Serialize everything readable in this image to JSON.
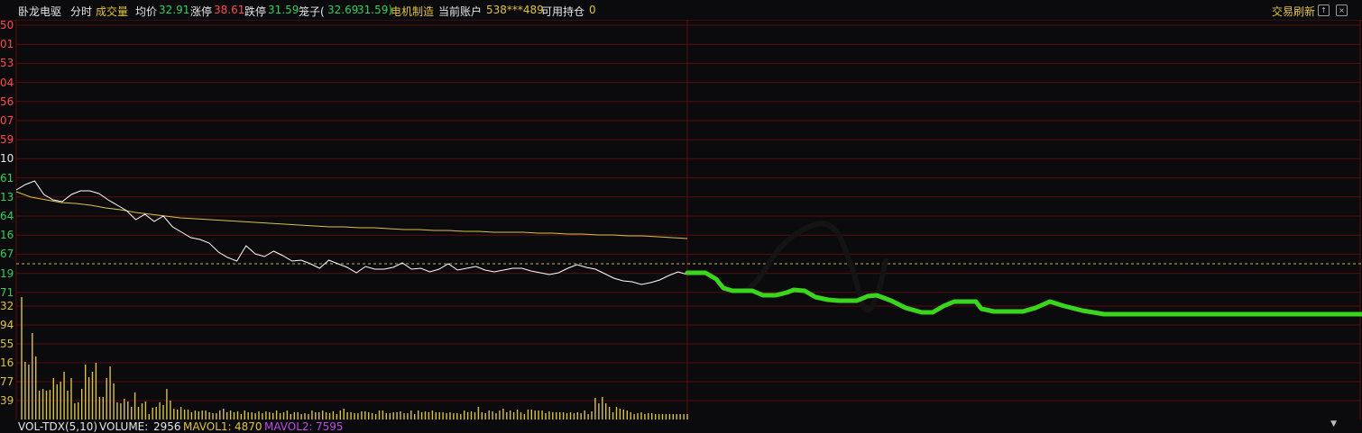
{
  "header": {
    "stock_name": "卧龙电驱",
    "mode_label": "分时",
    "volume_label": "成交量",
    "avg_label": "均价",
    "avg_value": "32.91",
    "limit_up_label": "涨停",
    "limit_up_value": "38.61",
    "limit_down_label": "跌停",
    "limit_down_value": "31.59",
    "basket_label": "笼子(",
    "basket_high": "32.69",
    "basket_low": "31.59)",
    "sector": "电机制造",
    "account_label": "当前账户",
    "account_value": "538***489",
    "position_label": "可用持仓",
    "position_value": "0",
    "refresh_label": "交易刷新"
  },
  "left_axis_labels": [
    {
      "text": "50",
      "color": "red"
    },
    {
      "text": "01",
      "color": "red"
    },
    {
      "text": "53",
      "color": "red"
    },
    {
      "text": "04",
      "color": "red"
    },
    {
      "text": "56",
      "color": "red"
    },
    {
      "text": "07",
      "color": "red"
    },
    {
      "text": "59",
      "color": "red"
    },
    {
      "text": "10",
      "color": "white"
    },
    {
      "text": "61",
      "color": "green"
    },
    {
      "text": "13",
      "color": "green"
    },
    {
      "text": "64",
      "color": "green"
    },
    {
      "text": "16",
      "color": "green"
    },
    {
      "text": "67",
      "color": "green"
    },
    {
      "text": "19",
      "color": "green"
    },
    {
      "text": "71",
      "color": "green"
    },
    {
      "text": "32",
      "color": "yellow"
    },
    {
      "text": "94",
      "color": "yellow"
    },
    {
      "text": "55",
      "color": "yellow"
    },
    {
      "text": "16",
      "color": "yellow"
    },
    {
      "text": "77",
      "color": "yellow"
    },
    {
      "text": "39",
      "color": "yellow"
    }
  ],
  "footer": {
    "indicator": "VOL-TDX(5,10)",
    "volume_label": "VOLUME:",
    "volume_value": "2956",
    "mavol1_label": "MAVOL1:",
    "mavol1_value": "4870",
    "mavol2_label": "MAVOL2:",
    "mavol2_value": "7595"
  },
  "colors": {
    "grid": "#5a0d0d",
    "price_line": "#ffffff",
    "avg_line": "#d8c24a",
    "drawn_green": "#3ad61e",
    "drawn_black": "#141414",
    "volume_bar": "#d8c24a"
  },
  "chart_data": {
    "type": "line",
    "series": [
      {
        "values": [
          211,
          205,
          201,
          216,
          222,
          224,
          216,
          212,
          212,
          215,
          222,
          228,
          234,
          244,
          238,
          246,
          240,
          252,
          258,
          264,
          266,
          270,
          280,
          286,
          290,
          273,
          282,
          285,
          279,
          284,
          290,
          289,
          293,
          298,
          289,
          293,
          297,
          303,
          296,
          299,
          299,
          297,
          292,
          299,
          298,
          302,
          299,
          293,
          300,
          298,
          296,
          300,
          302,
          300,
          298,
          298,
          301,
          303,
          305,
          303,
          298,
          294,
          297,
          299,
          304,
          309,
          312,
          313,
          316,
          314,
          311,
          306,
          302,
          305
        ]
      },
      {
        "values": [
          213,
          219,
          222,
          225,
          226,
          228,
          231,
          233,
          236,
          238,
          240,
          242,
          243,
          244,
          245,
          246,
          247,
          248,
          249,
          250,
          251,
          252,
          252,
          253,
          253,
          254,
          255,
          255,
          256,
          256,
          257,
          257,
          258,
          258,
          258,
          259,
          259,
          260,
          260,
          261,
          261,
          262,
          262,
          263,
          264,
          265
        ]
      },
      {
        "values": [
          330,
          402,
          405,
          370,
          396,
          434,
          432,
          434,
          433,
          420,
          427,
          424,
          413,
          434,
          420,
          448,
          447,
          432,
          405,
          419,
          413,
          403,
          441,
          441,
          420,
          407,
          426,
          447,
          448,
          443,
          446,
          452,
          436,
          452,
          448,
          446,
          460,
          453,
          452,
          447,
          450,
          432,
          445,
          454,
          455,
          452,
          455,
          455,
          458,
          456,
          457,
          456,
          456,
          458,
          459,
          459,
          456,
          454,
          458,
          456,
          458,
          457,
          460,
          456,
          458,
          458,
          459,
          457,
          459,
          457,
          458,
          459,
          456,
          459,
          458,
          456,
          460,
          458,
          458,
          460,
          459,
          460,
          456,
          458,
          458,
          456,
          458,
          459,
          457,
          460,
          456,
          454,
          458,
          458,
          459,
          459,
          457,
          457,
          458,
          459,
          460,
          456,
          456,
          459,
          459,
          458,
          458,
          457,
          459,
          459,
          456,
          460,
          456,
          458,
          457,
          458,
          456,
          458,
          458,
          458,
          459,
          458,
          459,
          459,
          460,
          456,
          458,
          457,
          458,
          452,
          458,
          459,
          456,
          457,
          459,
          456,
          454,
          458,
          456,
          458,
          455,
          458,
          460,
          455,
          455,
          456,
          456,
          456,
          459,
          457,
          458,
          458,
          458,
          458,
          459,
          458,
          459,
          458,
          459,
          456,
          460,
          457,
          442,
          448,
          441,
          448,
          452,
          458,
          452,
          454,
          455,
          456,
          458,
          460,
          459,
          458,
          460,
          459,
          459,
          460,
          460,
          460,
          460,
          460,
          460,
          460,
          460,
          460,
          460
        ]
      }
    ]
  }
}
